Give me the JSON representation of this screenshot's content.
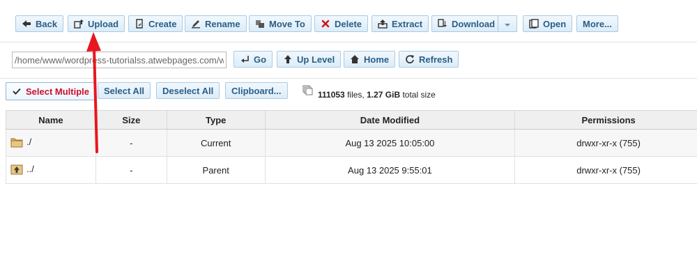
{
  "toolbar": {
    "back": "Back",
    "upload": "Upload",
    "create": "Create",
    "rename": "Rename",
    "move_to": "Move To",
    "delete": "Delete",
    "extract": "Extract",
    "download": "Download",
    "open": "Open",
    "more": "More..."
  },
  "nav": {
    "path_value": "/home/www/wordpress-tutorialss.atwebpages.com/wp-co",
    "go": "Go",
    "up_level": "Up Level",
    "home": "Home",
    "refresh": "Refresh"
  },
  "selection": {
    "select_multiple": "Select Multiple",
    "select_all": "Select All",
    "deselect_all": "Deselect All",
    "clipboard": "Clipboard..."
  },
  "stats": {
    "file_count": "111053",
    "files_label": "files,",
    "total_size": "1.27 GiB",
    "size_label": "total size"
  },
  "table": {
    "headers": [
      "Name",
      "Size",
      "Type",
      "Date Modified",
      "Permissions"
    ],
    "rows": [
      {
        "icon": "folder-icon",
        "name": "./",
        "size": "-",
        "type": "Current",
        "date": "Aug 13 2025 10:05:00",
        "perms": "drwxr-xr-x (755)"
      },
      {
        "icon": "parent-folder-icon",
        "name": "../",
        "size": "-",
        "type": "Parent",
        "date": "Aug 13 2025 9:55:01",
        "perms": "drwxr-xr-x (755)"
      }
    ]
  },
  "colors": {
    "button_text": "#2b5e86",
    "button_border": "#a9cbe4",
    "annotation_arrow": "#e8161f",
    "select_multiple_text": "#c8102e"
  }
}
